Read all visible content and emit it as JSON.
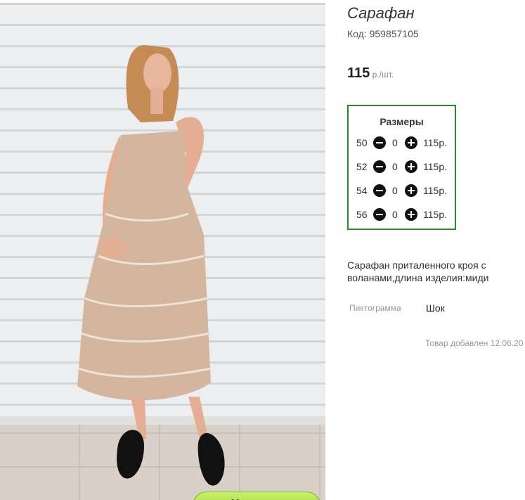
{
  "product": {
    "title": "Сарафан",
    "code_text": "Код: 959857105",
    "price_value": "115",
    "price_unit": " р./шт."
  },
  "sizes": {
    "title": "Размеры",
    "rows": [
      {
        "size": "50",
        "qty": "0",
        "price": "115р."
      },
      {
        "size": "52",
        "qty": "0",
        "price": "115р."
      },
      {
        "size": "54",
        "qty": "0",
        "price": "115р."
      },
      {
        "size": "56",
        "qty": "0",
        "price": "115р."
      }
    ]
  },
  "description": "Сарафан приталенного кроя с воланами,длина изделия:миди",
  "attributes": {
    "label": "Пиктограмма",
    "value": "Шок"
  },
  "added_text": "Товар добавлен 12.06.20",
  "photo": {
    "zoom_label": "+ Увеличить"
  },
  "colors": {
    "size_box_border": "#248a2a",
    "zoom_button": "#a6e040"
  }
}
